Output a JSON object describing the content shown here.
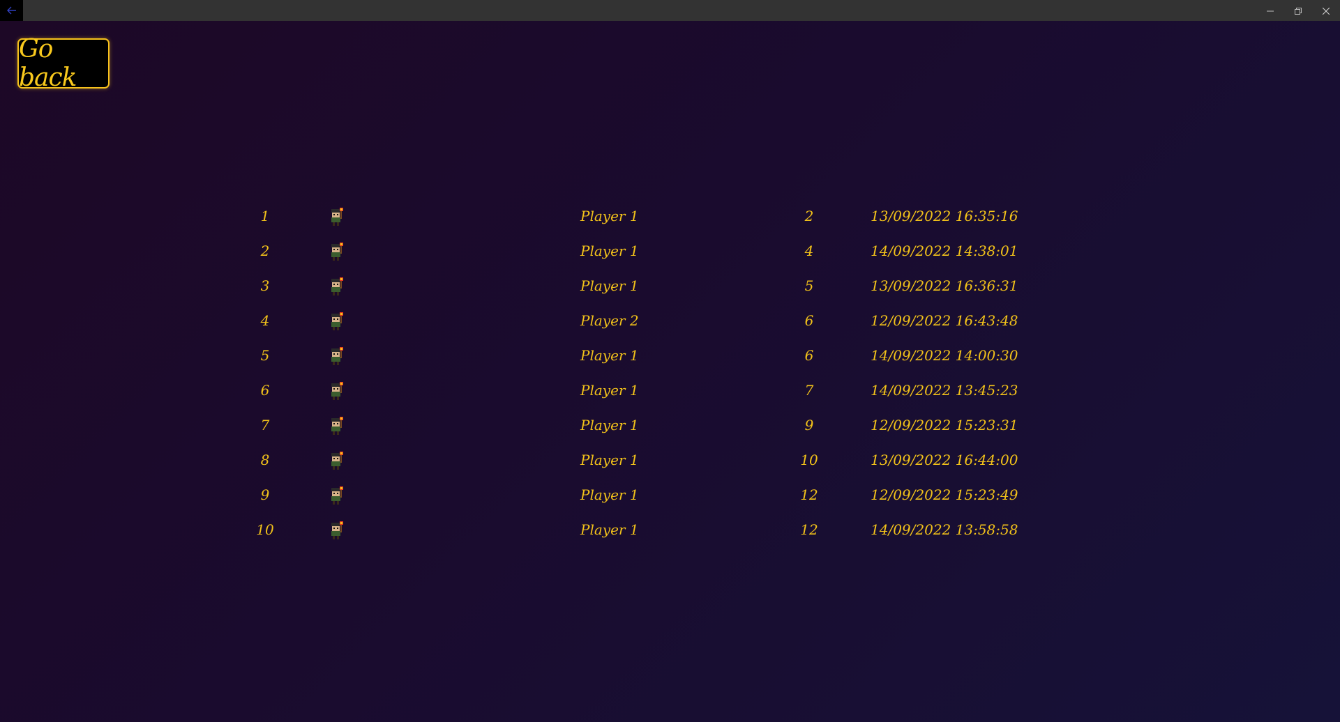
{
  "window": {
    "back_icon": "back-arrow-icon",
    "controls": [
      "minimize-icon",
      "restore-icon",
      "close-icon"
    ]
  },
  "go_back_label": "Go back",
  "colors": {
    "accent": "#f7c21c",
    "background_start": "#1d0826",
    "background_end": "#161238",
    "titlebar": "#333333"
  },
  "rows": [
    {
      "rank": "1",
      "avatar": "player-sprite-icon",
      "name": "Player 1",
      "score": "2",
      "date": "13/09/2022 16:35:16"
    },
    {
      "rank": "2",
      "avatar": "player-sprite-icon",
      "name": "Player 1",
      "score": "4",
      "date": "14/09/2022 14:38:01"
    },
    {
      "rank": "3",
      "avatar": "player-sprite-icon",
      "name": "Player 1",
      "score": "5",
      "date": "13/09/2022 16:36:31"
    },
    {
      "rank": "4",
      "avatar": "player-sprite-icon",
      "name": "Player 2",
      "score": "6",
      "date": "12/09/2022 16:43:48"
    },
    {
      "rank": "5",
      "avatar": "player-sprite-icon",
      "name": "Player 1",
      "score": "6",
      "date": "14/09/2022 14:00:30"
    },
    {
      "rank": "6",
      "avatar": "player-sprite-icon",
      "name": "Player 1",
      "score": "7",
      "date": "14/09/2022 13:45:23"
    },
    {
      "rank": "7",
      "avatar": "player-sprite-icon",
      "name": "Player 1",
      "score": "9",
      "date": "12/09/2022 15:23:31"
    },
    {
      "rank": "8",
      "avatar": "player-sprite-icon",
      "name": "Player 1",
      "score": "10",
      "date": "13/09/2022 16:44:00"
    },
    {
      "rank": "9",
      "avatar": "player-sprite-icon",
      "name": "Player 1",
      "score": "12",
      "date": "12/09/2022 15:23:49"
    },
    {
      "rank": "10",
      "avatar": "player-sprite-icon",
      "name": "Player 1",
      "score": "12",
      "date": "14/09/2022 13:58:58"
    }
  ]
}
